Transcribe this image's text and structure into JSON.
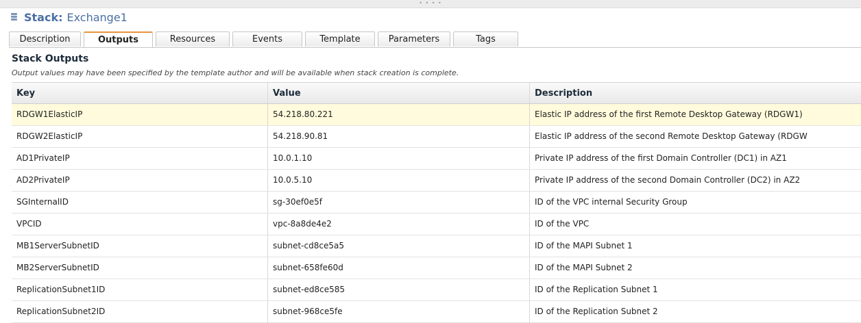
{
  "header": {
    "label": "Stack:",
    "value": "Exchange1"
  },
  "tabs": [
    {
      "label": "Description",
      "active": false
    },
    {
      "label": "Outputs",
      "active": true
    },
    {
      "label": "Resources",
      "active": false
    },
    {
      "label": "Events",
      "active": false
    },
    {
      "label": "Template",
      "active": false
    },
    {
      "label": "Parameters",
      "active": false
    },
    {
      "label": "Tags",
      "active": false
    }
  ],
  "section": {
    "title": "Stack Outputs",
    "description": "Output values may have been specified by the template author and will be available when stack creation is complete."
  },
  "table": {
    "columns": [
      "Key",
      "Value",
      "Description"
    ],
    "rows": [
      {
        "key": "RDGW1ElasticIP",
        "value": "54.218.80.221",
        "description": "Elastic IP address of the first Remote Desktop Gateway (RDGW1)",
        "selected": true
      },
      {
        "key": "RDGW2ElasticIP",
        "value": "54.218.90.81",
        "description": "Elastic IP address of the second Remote Desktop Gateway (RDGW",
        "selected": false
      },
      {
        "key": "AD1PrivateIP",
        "value": "10.0.1.10",
        "description": "Private IP address of the first Domain Controller (DC1) in AZ1",
        "selected": false
      },
      {
        "key": "AD2PrivateIP",
        "value": "10.0.5.10",
        "description": "Private IP address of the second Domain Controller (DC2) in AZ2",
        "selected": false
      },
      {
        "key": "SGInternalID",
        "value": "sg-30ef0e5f",
        "description": "ID of the VPC internal Security Group",
        "selected": false
      },
      {
        "key": "VPCID",
        "value": "vpc-8a8de4e2",
        "description": "ID of the VPC",
        "selected": false
      },
      {
        "key": "MB1ServerSubnetID",
        "value": "subnet-cd8ce5a5",
        "description": "ID of the MAPI Subnet 1",
        "selected": false
      },
      {
        "key": "MB2ServerSubnetID",
        "value": "subnet-658fe60d",
        "description": "ID of the MAPI Subnet 2",
        "selected": false
      },
      {
        "key": "ReplicationSubnet1ID",
        "value": "subnet-ed8ce585",
        "description": "ID of the Replication Subnet 1",
        "selected": false
      },
      {
        "key": "ReplicationSubnet2ID",
        "value": "subnet-968ce5fe",
        "description": "ID of the Replication Subnet 2",
        "selected": false
      }
    ]
  },
  "colors": {
    "title": "#4a6fa5",
    "active_tab_accent": "#e8923a",
    "selected_row": "#fffbdc"
  },
  "icons": {
    "stack": "stack-icon",
    "resize": "resize-grip-icon"
  }
}
